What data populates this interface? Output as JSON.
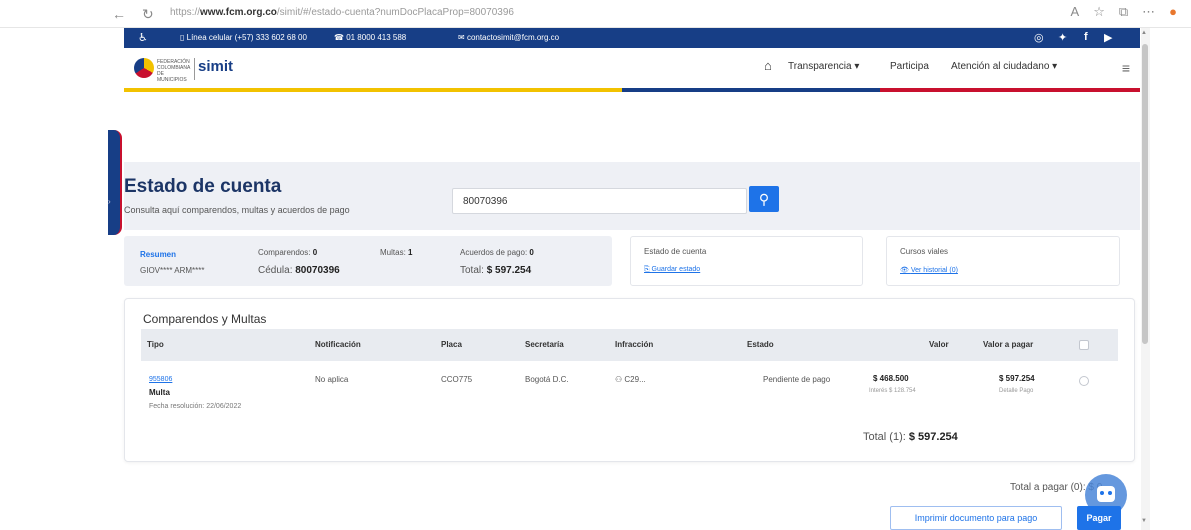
{
  "browser": {
    "url_prefix": "https://",
    "url_host": "www.fcm.org.co",
    "url_path": "/simit/#/estado-cuenta?numDocPlacaProp=80070396"
  },
  "topbar": {
    "phone_mobile": "Línea celular (+57) 333 602 68 00",
    "phone_landline": "01 8000 413 588",
    "email": "contactosimit@fcm.org.co"
  },
  "header": {
    "logo_text": "FEDERACIÓN COLOMBIANA DE MUNICIPIOS",
    "brand": "simit",
    "menu": [
      "Transparencia ▾",
      "Participa",
      "Atención al ciudadano ▾"
    ]
  },
  "hero": {
    "title": "Estado de cuenta",
    "subtitle": "Consulta aquí comparendos, multas y acuerdos de pago",
    "search_value": "80070396"
  },
  "summary": {
    "label": "Resumen",
    "name": "GIOV**** ARM****",
    "comparendos_label": "Comparendos:",
    "comparendos": "0",
    "multas_label": "Multas:",
    "multas": "1",
    "acuerdos_label": "Acuerdos de pago:",
    "acuerdos": "0",
    "cedula_label": "Cédula:",
    "cedula": "80070396",
    "total_label": "Total:",
    "total": "$ 597.254"
  },
  "estado_card": {
    "title": "Estado de cuenta",
    "link": "Guardar estado"
  },
  "cursos_card": {
    "title": "Cursos viales",
    "link": "Ver historial (0)"
  },
  "table": {
    "title": "Comparendos y Multas",
    "headers": [
      "Tipo",
      "Notificación",
      "Placa",
      "Secretaría",
      "Infracción",
      "Estado",
      "Valor",
      "Valor a pagar"
    ],
    "rows": [
      {
        "id": "955806",
        "tipo": "Multa",
        "fecha": "Fecha resolución: 22/06/2022",
        "notificacion": "No aplica",
        "placa": "CCO775",
        "secretaria": "Bogotá D.C.",
        "infraccion": "C29...",
        "estado": "Pendiente de pago",
        "valor": "$ 468.500",
        "interes": "Interés $ 128.754",
        "valor_pagar": "$ 597.254",
        "detalle": "Detalle Pago"
      }
    ],
    "total_label": "Total (1):",
    "total_value": "$ 597.254"
  },
  "footer": {
    "total_pagar": "Total a pagar (0): $ 0",
    "print_button": "Imprimir documento para pago",
    "pay_button": "Pagar"
  }
}
